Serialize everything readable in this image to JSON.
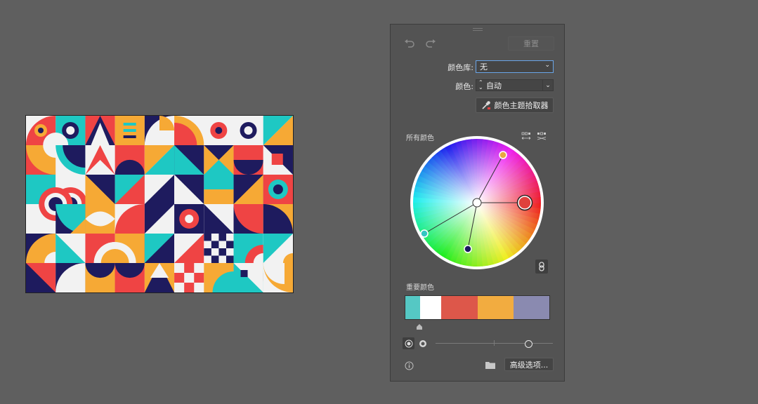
{
  "toolbar": {
    "undo_icon": "undo-icon",
    "redo_icon": "redo-icon",
    "reset_label": "重置"
  },
  "library": {
    "label": "颜色库:",
    "value": "无"
  },
  "colors": {
    "label": "颜色:",
    "value": "自动"
  },
  "picker": {
    "label": "颜色主题拾取器",
    "icon": "eyedropper-icon"
  },
  "wheel": {
    "section_label": "所有颜色",
    "handles": [
      {
        "name": "orange",
        "color": "#e9a840"
      },
      {
        "name": "red",
        "color": "#e0413c"
      },
      {
        "name": "cyan",
        "color": "#32c6c2"
      },
      {
        "name": "navy",
        "color": "#1a1a5e"
      }
    ]
  },
  "prominent": {
    "section_label": "重要颜色",
    "swatches": [
      "#55c8c4",
      "#ffffff",
      "#dd574a",
      "#f2ac40",
      "#8a8ab0"
    ],
    "swatch_fractions": [
      0.12,
      0.18,
      0.3,
      0.3,
      0.3
    ]
  },
  "bottom": {
    "advanced_label": "高级选项..."
  },
  "artwork": {
    "palette": {
      "red": "#ef4444",
      "navy": "#1e1b5e",
      "cyan": "#1ec8c3",
      "orange": "#f6a935",
      "white": "#f2f2f2"
    }
  }
}
